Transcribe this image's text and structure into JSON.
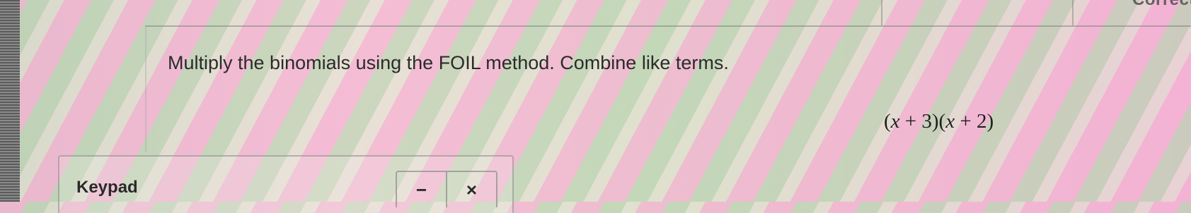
{
  "header": {
    "status_text": "Correct"
  },
  "question": {
    "instruction": "Multiply the binomials using the FOIL method. Combine like terms.",
    "expression": {
      "open1": "(",
      "var1": "x",
      "plus1": " + 3)(",
      "var2": "x",
      "plus2": " + 2)"
    }
  },
  "keypad": {
    "title": "Keypad",
    "minimize_label": "−",
    "close_label": "×",
    "minimize_icon": "minus-icon",
    "close_icon": "close-icon"
  }
}
